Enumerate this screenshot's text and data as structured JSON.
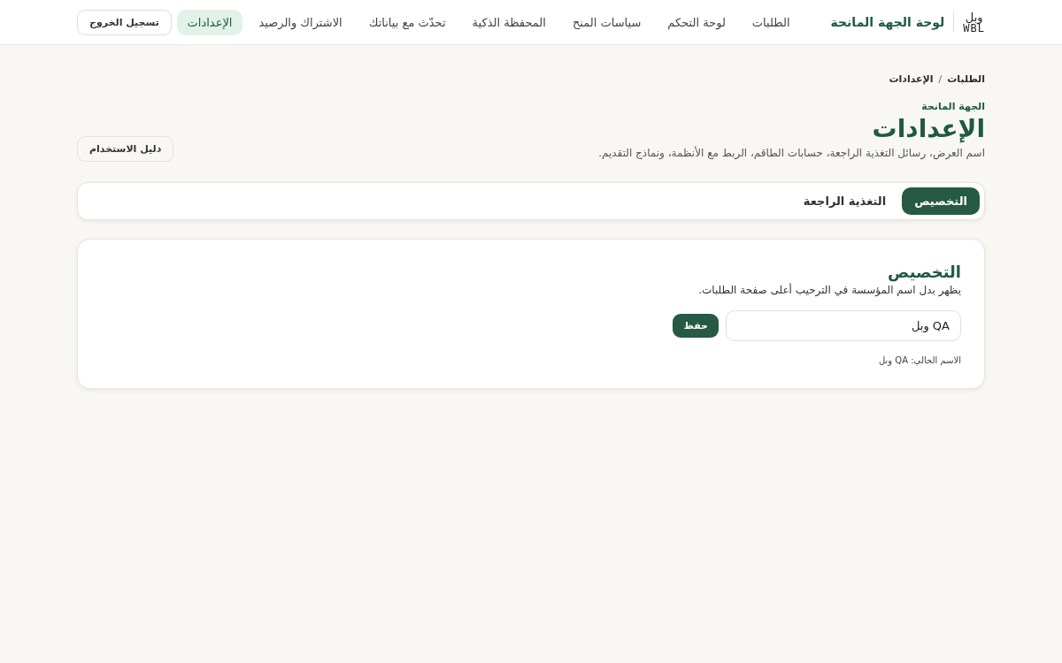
{
  "header": {
    "logo": {
      "arabic": "وبل",
      "latin": "WBL"
    },
    "title": "لوحة الجهة المانحة",
    "nav": [
      {
        "label": "الطلبات",
        "selected": false
      },
      {
        "label": "لوحة التحكم",
        "selected": false
      },
      {
        "label": "سياسات المنح",
        "selected": false
      },
      {
        "label": "المحفظة الذكية",
        "selected": false
      },
      {
        "label": "تحدّث مع بياناتك",
        "selected": false
      },
      {
        "label": "الاشتراك والرصيد",
        "selected": false
      },
      {
        "label": "الإعدادات",
        "selected": true
      }
    ],
    "logout": "تسجيل الخروج"
  },
  "breadcrumb": [
    "الطلبات",
    "/",
    "الإعدادات"
  ],
  "page": {
    "eyebrow": "الجهة المانحة",
    "title": "الإعدادات",
    "description": "اسم العرض، رسائل التغذية الراجعة، حسابات الطاقم، الربط مع الأنظمة، ونماذج التقديم.",
    "guide_button": "دليل الاستخدام"
  },
  "tabs": [
    {
      "label": "التخصيص",
      "selected": true
    },
    {
      "label": "التغذية الراجعة",
      "selected": false
    }
  ],
  "card": {
    "title": "التخصيص",
    "description": "يظهر بدل اسم المؤسسة في الترحيب أعلى صفحة الطلبات.",
    "field": {
      "value": "QA وبل"
    },
    "save": "حفظ",
    "current": "الاسم الحالي: QA وبل"
  }
}
